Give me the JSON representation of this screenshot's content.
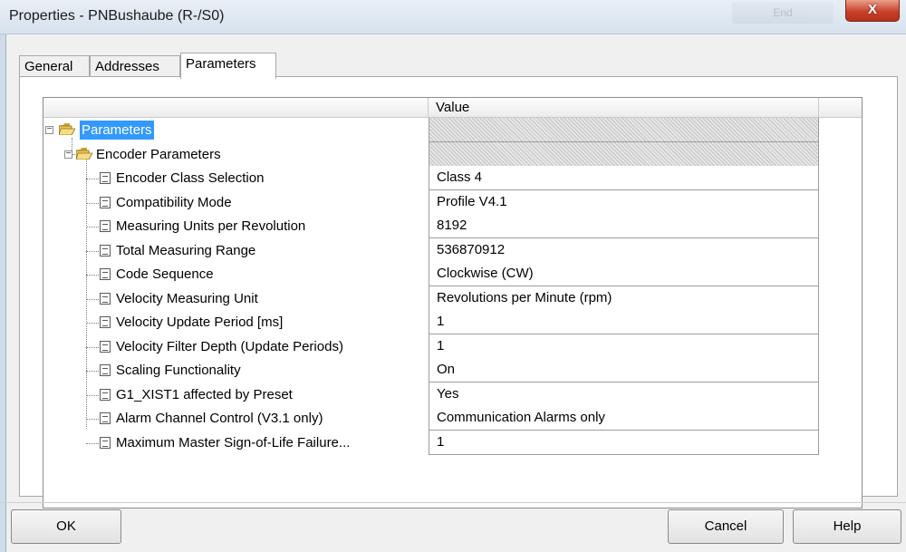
{
  "window": {
    "title": "Properties - PNBushaube  (R-/S0)",
    "faded_button": "End",
    "close_label": "X"
  },
  "tabs": [
    {
      "label": "General"
    },
    {
      "label": "Addresses"
    },
    {
      "label": "Parameters"
    }
  ],
  "grid": {
    "value_header": "Value",
    "root": {
      "label": "Parameters"
    },
    "group": {
      "label": "Encoder Parameters"
    },
    "params": [
      {
        "label": "Encoder Class Selection",
        "value": "Class 4"
      },
      {
        "label": "Compatibility Mode",
        "value": "Profile V4.1"
      },
      {
        "label": "Measuring Units per Revolution",
        "value": "8192"
      },
      {
        "label": "Total Measuring Range",
        "value": "536870912"
      },
      {
        "label": "Code Sequence",
        "value": "Clockwise (CW)"
      },
      {
        "label": "Velocity Measuring Unit",
        "value": "Revolutions per Minute (rpm)"
      },
      {
        "label": "Velocity Update Period [ms]",
        "value": "1"
      },
      {
        "label": "Velocity Filter Depth (Update Periods)",
        "value": "1"
      },
      {
        "label": "Scaling Functionality",
        "value": "On"
      },
      {
        "label": "G1_XIST1 affected by Preset",
        "value": "Yes"
      },
      {
        "label": "Alarm Channel Control (V3.1 only)",
        "value": "Communication Alarms only"
      },
      {
        "label": "Maximum Master Sign-of-Life Failure...",
        "value": "1"
      }
    ]
  },
  "buttons": {
    "ok": "OK",
    "cancel": "Cancel",
    "help": "Help"
  },
  "colors": {
    "selection": "#3399ff",
    "close_red": "#c9412b"
  }
}
